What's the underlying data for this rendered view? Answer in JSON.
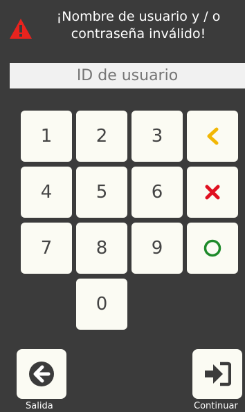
{
  "alert": {
    "line1": "¡Nombre de usuario y / o",
    "line2": "contraseña inválido!",
    "icon": "warning-triangle-icon",
    "icon_color": "#e8231e"
  },
  "user_id": {
    "placeholder": "ID de usuario",
    "value": ""
  },
  "keypad": {
    "digits": [
      "1",
      "2",
      "3",
      "4",
      "5",
      "6",
      "7",
      "8",
      "9",
      "0"
    ],
    "back_icon": "chevron-left-icon",
    "back_color": "#f2b705",
    "clear_icon": "x-icon",
    "clear_color": "#e01020",
    "ok_icon": "circle-icon",
    "ok_color": "#1e8a2a"
  },
  "footer": {
    "exit_label": "Salida",
    "exit_icon": "arrow-left-circle-icon",
    "continue_label": "Continuar",
    "continue_icon": "sign-in-icon"
  }
}
